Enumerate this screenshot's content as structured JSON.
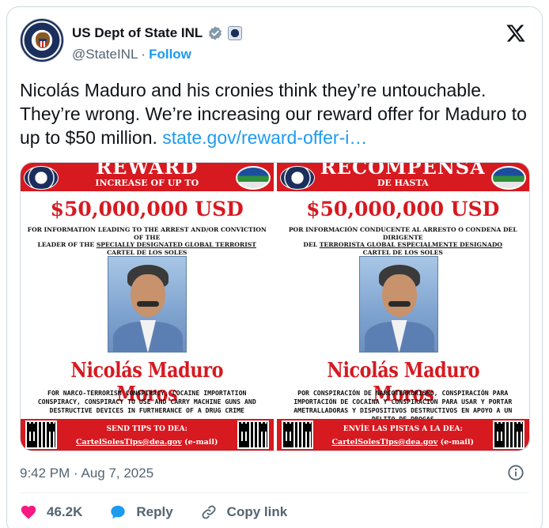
{
  "account": {
    "display_name": "US Dept of State INL",
    "handle": "@StateINL",
    "separator": "·",
    "follow_label": "Follow"
  },
  "tweet": {
    "text": "Nicolás Maduro and his cronies think they’re untouchable. They’re wrong. We’re increasing our reward offer for Maduro to up to $50 million.",
    "link_text": "state.gov/reward-offer-i…"
  },
  "posters": {
    "english": {
      "heading": "REWARD",
      "subheading": "INCREASE OF UP TO",
      "amount": "$50,000,000 USD",
      "info_line1": "FOR INFORMATION LEADING TO THE ARREST AND/OR CONVICTION OF THE",
      "info_line2_prefix": "LEADER OF THE ",
      "info_line2_link": "SPECIALLY DESIGNATED GLOBAL TERRORIST",
      "info_line3": "CARTEL DE LOS SOLES",
      "name": "Nicolás Maduro Moros",
      "charges": "FOR NARCO-TERRORISM CONSPIRACY, COCAINE IMPORTATION CONSPIRACY, CONSPIRACY TO USE AND CARRY MACHINE GUNS AND DESTRUCTIVE DEVICES IN FURTHERANCE OF A DRUG CRIME",
      "tips_title": "SEND TIPS TO DEA:",
      "tips_email": "CartelSolesTips@dea.gov",
      "tips_suffix": " (e-mail)"
    },
    "spanish": {
      "heading": "RECOMPENSA",
      "subheading": "DE HASTA",
      "amount": "$50,000,000 USD",
      "info_line1": "POR INFORMACIÓN CONDUCENTE AL ARRESTO O CONDENA DEL DIRIGENTE",
      "info_line2_prefix": "DEL ",
      "info_line2_link": "TERRORISTA GLOBAL ESPECIALMENTE DESIGNADO",
      "info_line3": "CARTEL DE LOS SOLES",
      "name": "Nicolás Maduro Moros",
      "charges": "POR CONSPIRACIÓN DE NARCOTERRORISMO, CONSPIRACIÓN PARA IMPORTACIÓN DE COCAÍNA Y CONSPIRACIÓN PARA USAR Y PORTAR AMETRALLADORAS Y DISPOSITIVOS DESTRUCTIVOS EN APOYO A UN DELITO DE DROGAS",
      "tips_title": "ENVÍE LAS PISTAS A LA DEA:",
      "tips_email": "CartelSolesTips@dea.gov",
      "tips_suffix": " (e-mail)"
    }
  },
  "meta": {
    "timestamp": "9:42 PM · Aug 7, 2025"
  },
  "actions": {
    "like_count": "46.2K",
    "reply_label": "Reply",
    "copy_label": "Copy link"
  },
  "icons": {
    "verified": "gov-verified-badge-icon",
    "platform": "x-logo-icon",
    "info": "info-icon",
    "like": "heart-icon",
    "reply": "speech-bubble-icon",
    "copy": "link-icon"
  },
  "colors": {
    "link": "#1d9bf0",
    "poster_red": "#d71920",
    "like": "#f91880"
  }
}
